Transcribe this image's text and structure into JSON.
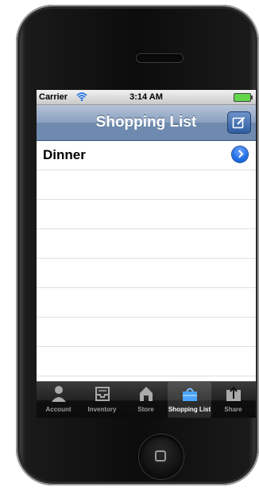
{
  "status_bar": {
    "carrier": "Carrier",
    "time": "3:14 AM"
  },
  "nav_bar": {
    "title": "Shopping List",
    "right_button_icon": "compose-icon"
  },
  "list": {
    "items": [
      {
        "label": "Dinner",
        "accessory": "disclosure-icon"
      }
    ]
  },
  "tab_bar": {
    "tabs": [
      {
        "label": "Account",
        "icon": "person-icon",
        "selected": false
      },
      {
        "label": "Inventory",
        "icon": "inbox-tray-icon",
        "selected": false
      },
      {
        "label": "Store",
        "icon": "store-icon",
        "selected": false
      },
      {
        "label": "Shopping List",
        "icon": "basket-icon",
        "selected": true
      },
      {
        "label": "Share",
        "icon": "share-icon",
        "selected": false
      }
    ]
  },
  "colors": {
    "nav_bar": "#7c95b8",
    "tab_selected_accent": "#4aa3ff",
    "disclosure": "#1f6fe6"
  }
}
